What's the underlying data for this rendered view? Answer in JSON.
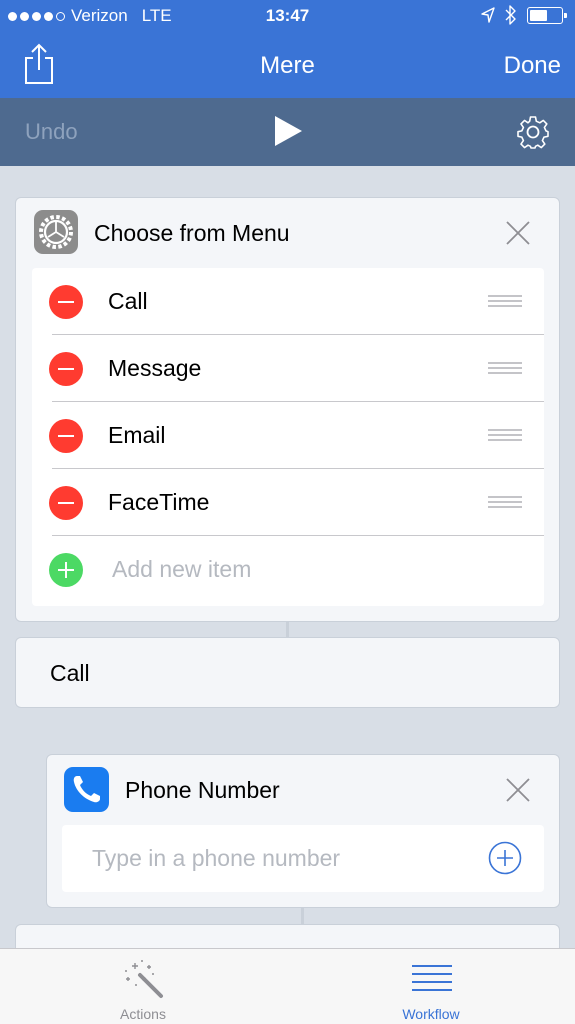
{
  "status_bar": {
    "carrier": "Verizon",
    "network": "LTE",
    "time": "13:47",
    "signal_bars": 4,
    "signal_max": 5,
    "battery_level": 0.5
  },
  "nav": {
    "title": "Mere",
    "done_label": "Done",
    "share_icon": "share-icon"
  },
  "toolbar": {
    "undo_label": "Undo",
    "play_icon": "play-icon",
    "settings_icon": "gear-icon"
  },
  "menu_action": {
    "title": "Choose from Menu",
    "icon": "gear-icon",
    "items": [
      "Call",
      "Message",
      "Email",
      "FaceTime"
    ],
    "add_placeholder": "Add new item"
  },
  "case_block": {
    "label": "Call"
  },
  "phone_action": {
    "title": "Phone Number",
    "icon": "phone-icon",
    "input_placeholder": "Type in a phone number"
  },
  "tab_bar": {
    "tabs": [
      {
        "label": "Actions",
        "icon": "magic-wand-icon",
        "active": false
      },
      {
        "label": "Workflow",
        "icon": "list-icon",
        "active": true
      }
    ]
  },
  "colors": {
    "accent": "#3a74d6",
    "delete": "#ff3b30",
    "add": "#4cd964",
    "phone": "#1a7cf0"
  }
}
